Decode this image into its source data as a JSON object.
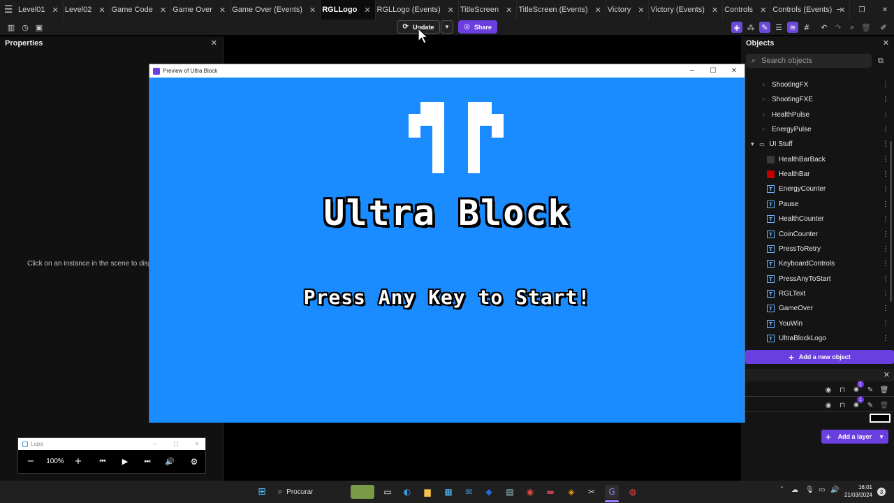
{
  "tabs": [
    {
      "label": "Level01",
      "active": false
    },
    {
      "label": "Level02",
      "active": false
    },
    {
      "label": "Game Code",
      "active": false
    },
    {
      "label": "Game Over",
      "active": false
    },
    {
      "label": "Game Over (Events)",
      "active": false
    },
    {
      "label": "RGLLogo",
      "active": true
    },
    {
      "label": "RGLLogo (Events)",
      "active": false
    },
    {
      "label": "TitleScreen",
      "active": false
    },
    {
      "label": "TitleScreen (Events)",
      "active": false
    },
    {
      "label": "Victory",
      "active": false
    },
    {
      "label": "Victory (Events)",
      "active": false
    },
    {
      "label": "Controls",
      "active": false
    },
    {
      "label": "Controls (Events)",
      "active": false
    }
  ],
  "toolbar": {
    "update_label": "Update",
    "share_label": "Share"
  },
  "properties": {
    "title": "Properties",
    "hint": "Click on an instance in the scene to display"
  },
  "objects": {
    "title": "Objects",
    "search_placeholder": "Search objects",
    "items": [
      {
        "label": "ShootingFX",
        "kind": "particle",
        "indent": 1
      },
      {
        "label": "ShootingFXE",
        "kind": "particle",
        "indent": 1
      },
      {
        "label": "HealthPulse",
        "kind": "particle",
        "indent": 1
      },
      {
        "label": "EnergyPulse",
        "kind": "particle",
        "indent": 1
      },
      {
        "label": "UI Stuff",
        "kind": "folder",
        "indent": 0
      },
      {
        "label": "HealthBarBack",
        "kind": "swatch-dark",
        "indent": 2
      },
      {
        "label": "HealthBar",
        "kind": "swatch-red",
        "indent": 2
      },
      {
        "label": "EnergyCounter",
        "kind": "text",
        "indent": 2
      },
      {
        "label": "Pause",
        "kind": "text",
        "indent": 2
      },
      {
        "label": "HealthCounter",
        "kind": "text",
        "indent": 2
      },
      {
        "label": "CoinCounter",
        "kind": "text",
        "indent": 2
      },
      {
        "label": "PressToRetry",
        "kind": "text",
        "indent": 2
      },
      {
        "label": "KeyboardControls",
        "kind": "text",
        "indent": 2
      },
      {
        "label": "PressAnyToStart",
        "kind": "text",
        "indent": 2
      },
      {
        "label": "RGLText",
        "kind": "text",
        "indent": 2
      },
      {
        "label": "GameOver",
        "kind": "text",
        "indent": 2
      },
      {
        "label": "YouWin",
        "kind": "text",
        "indent": 2
      },
      {
        "label": "UltraBlockLogo",
        "kind": "text",
        "indent": 2
      }
    ],
    "add_label": "Add a new object"
  },
  "layers": {
    "badge_count": "1",
    "add_label": "Add a layer"
  },
  "preview": {
    "window_title": "Preview of Ultra Block",
    "game_title": "Ultra Block",
    "prompt": "Press Any Key to Start!",
    "bg_color": "#1a8cff"
  },
  "magnifier": {
    "title": "Lupa",
    "zoom": "100%"
  },
  "taskbar": {
    "search_label": "Procurar",
    "time": "16:01",
    "date": "21/03/2024",
    "notifications": "3"
  }
}
